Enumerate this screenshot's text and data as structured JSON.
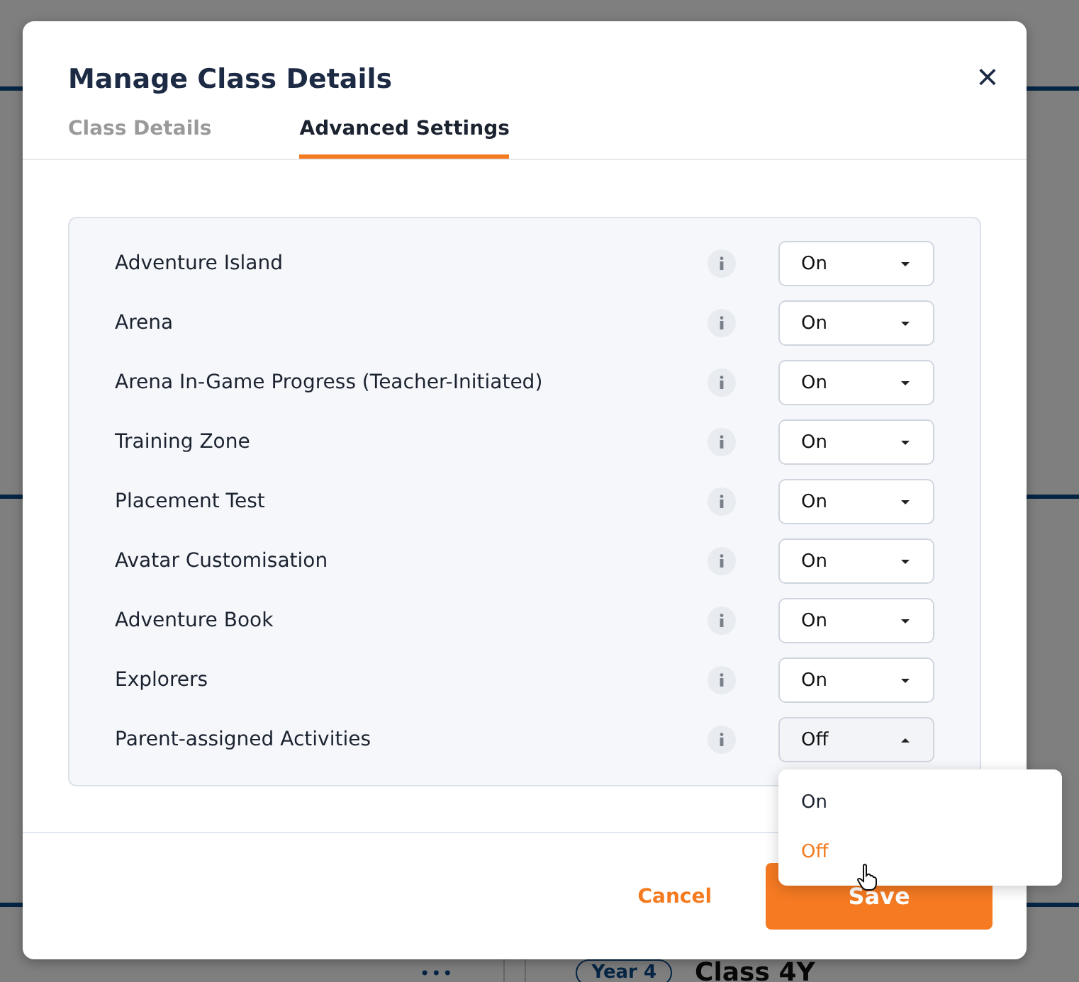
{
  "background": {
    "dots": "•••",
    "tag": "Year 4",
    "class_name": "Class 4Y"
  },
  "dialog": {
    "title": "Manage Class Details",
    "close": "×",
    "tabs": [
      {
        "label": "Class Details",
        "selected": false
      },
      {
        "label": "Advanced Settings",
        "selected": true
      }
    ],
    "settings": [
      {
        "label": "Adventure Island",
        "value": "On",
        "expanded": false
      },
      {
        "label": "Arena",
        "value": "On",
        "expanded": false
      },
      {
        "label": "Arena In-Game Progress (Teacher-Initiated)",
        "value": "On",
        "expanded": false
      },
      {
        "label": "Training Zone",
        "value": "On",
        "expanded": false
      },
      {
        "label": "Placement Test",
        "value": "On",
        "expanded": false
      },
      {
        "label": "Avatar Customisation",
        "value": "On",
        "expanded": false
      },
      {
        "label": "Adventure Book",
        "value": "On",
        "expanded": false
      },
      {
        "label": "Explorers",
        "value": "On",
        "expanded": false
      },
      {
        "label": "Parent-assigned Activities",
        "value": "Off",
        "expanded": true,
        "options": [
          {
            "label": "On",
            "selected": false
          },
          {
            "label": "Off",
            "selected": true
          }
        ]
      }
    ],
    "buttons": [
      {
        "label": "Cancel",
        "kind": "text"
      },
      {
        "label": "Save",
        "kind": "primary"
      }
    ]
  }
}
